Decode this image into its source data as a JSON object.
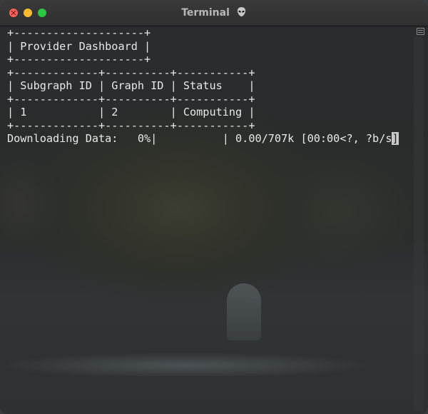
{
  "window": {
    "title": "Terminal",
    "title_icon": "alien-emoji"
  },
  "terminal": {
    "lines": [
      "+--------------------+",
      "| Provider Dashboard |",
      "+--------------------+",
      "+-------------+----------+-----------+",
      "| Subgraph ID | Graph ID | Status    |",
      "+-------------+----------+-----------+",
      "| 1           | 2        | Computing |",
      "+-------------+----------+-----------+"
    ],
    "progress_text": "Downloading Data:   0%|          | 0.00/707k [00:00<?, ?b/s",
    "cursor_char": "]"
  },
  "colors": {
    "close": "#ff5f57",
    "minimize": "#febc2e",
    "maximize": "#28c840",
    "text": "#e8e8e8"
  }
}
